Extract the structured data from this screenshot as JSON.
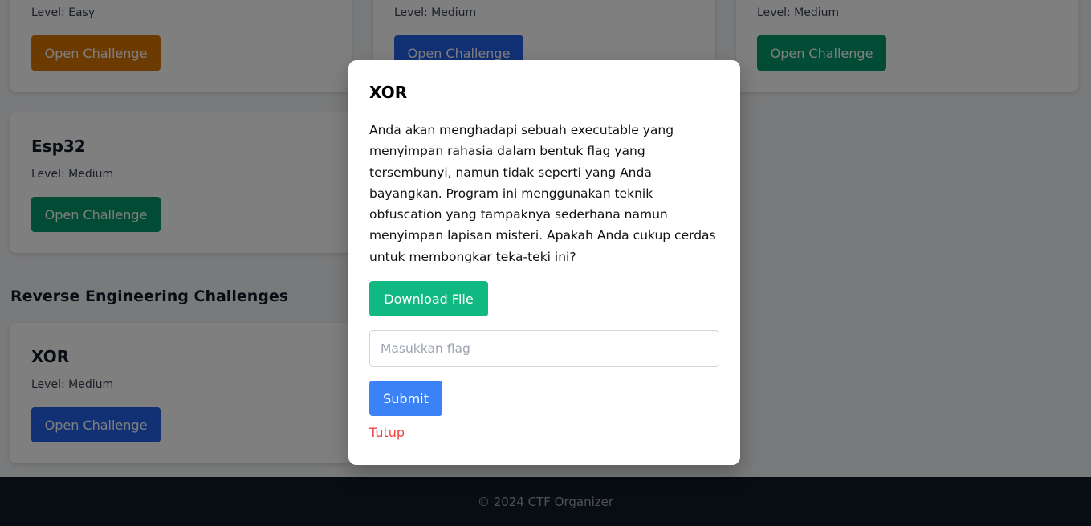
{
  "colors": {
    "easy": "#d97706",
    "medium_green": "#059669",
    "medium_blue": "#2563eb",
    "download": "#10b981",
    "submit": "#3b82f6",
    "close": "#ef4444",
    "footer_bg": "#111827"
  },
  "cards_top_row": [
    {
      "level": "Level: Easy",
      "button": "Open Challenge"
    },
    {
      "level": "Level: Medium",
      "button": "Open Challenge"
    },
    {
      "level": "Level: Medium",
      "button": "Open Challenge"
    }
  ],
  "esp32_card": {
    "title": "Esp32",
    "level": "Level: Medium",
    "button": "Open Challenge"
  },
  "reverse_section": {
    "heading": "Reverse Engineering Challenges",
    "card": {
      "title": "XOR",
      "level": "Level: Medium",
      "button": "Open Challenge"
    }
  },
  "modal": {
    "title": "XOR",
    "description": "Anda akan menghadapi sebuah executable yang menyimpan rahasia dalam bentuk flag yang tersembunyi, namun tidak seperti yang Anda bayangkan. Program ini menggunakan teknik obfuscation yang tampaknya sederhana namun menyimpan lapisan misteri. Apakah Anda cukup cerdas untuk membongkar teka-teki ini?",
    "download_label": "Download File",
    "flag_placeholder": "Masukkan flag",
    "flag_value": "",
    "submit_label": "Submit",
    "close_label": "Tutup"
  },
  "footer": {
    "text": "© 2024 CTF Organizer"
  }
}
